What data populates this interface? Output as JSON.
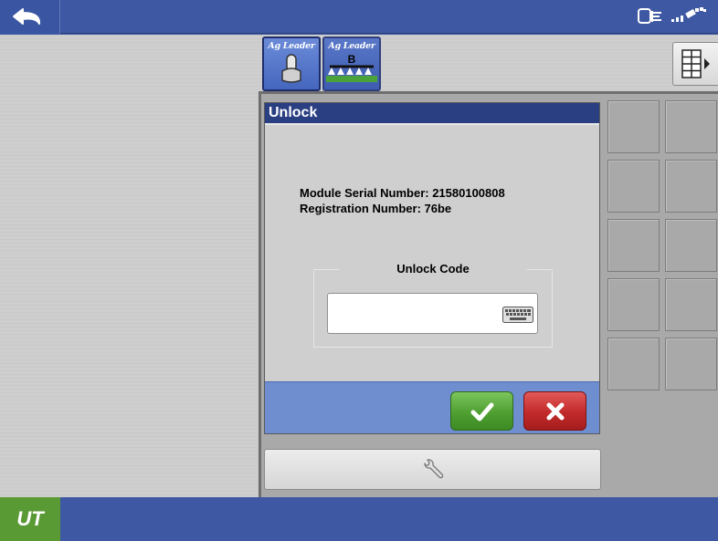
{
  "top_bar": {
    "back_icon": "back-arrow-icon",
    "status_icons": [
      "display-connector-icon",
      "gps-satellite-icon"
    ]
  },
  "module_tabs": [
    {
      "label": "Ag Leader",
      "icon": "joystick-icon",
      "active": true
    },
    {
      "label": "Ag Leader",
      "icon": "sprayer-boom-icon",
      "badge": "B",
      "active": false
    }
  ],
  "dialog": {
    "title": "Unlock",
    "serial_label": "Module Serial Number: 21580100808",
    "registration_label": "Registration Number: 76be",
    "unlock_group_label": "Unlock Code",
    "unlock_code_value": "",
    "keyboard_icon": "keyboard-icon",
    "ok_icon": "checkmark-icon",
    "cancel_icon": "x-icon"
  },
  "tool_button": {
    "icon": "wrench-icon"
  },
  "bottom_bar": {
    "ut_label": "UT"
  },
  "colors": {
    "bar_blue": "#3e58a3",
    "title_blue": "#2a3f82",
    "ok_green": "#4f9f31",
    "cancel_red": "#c22a2a",
    "ut_green": "#5a9a35"
  }
}
